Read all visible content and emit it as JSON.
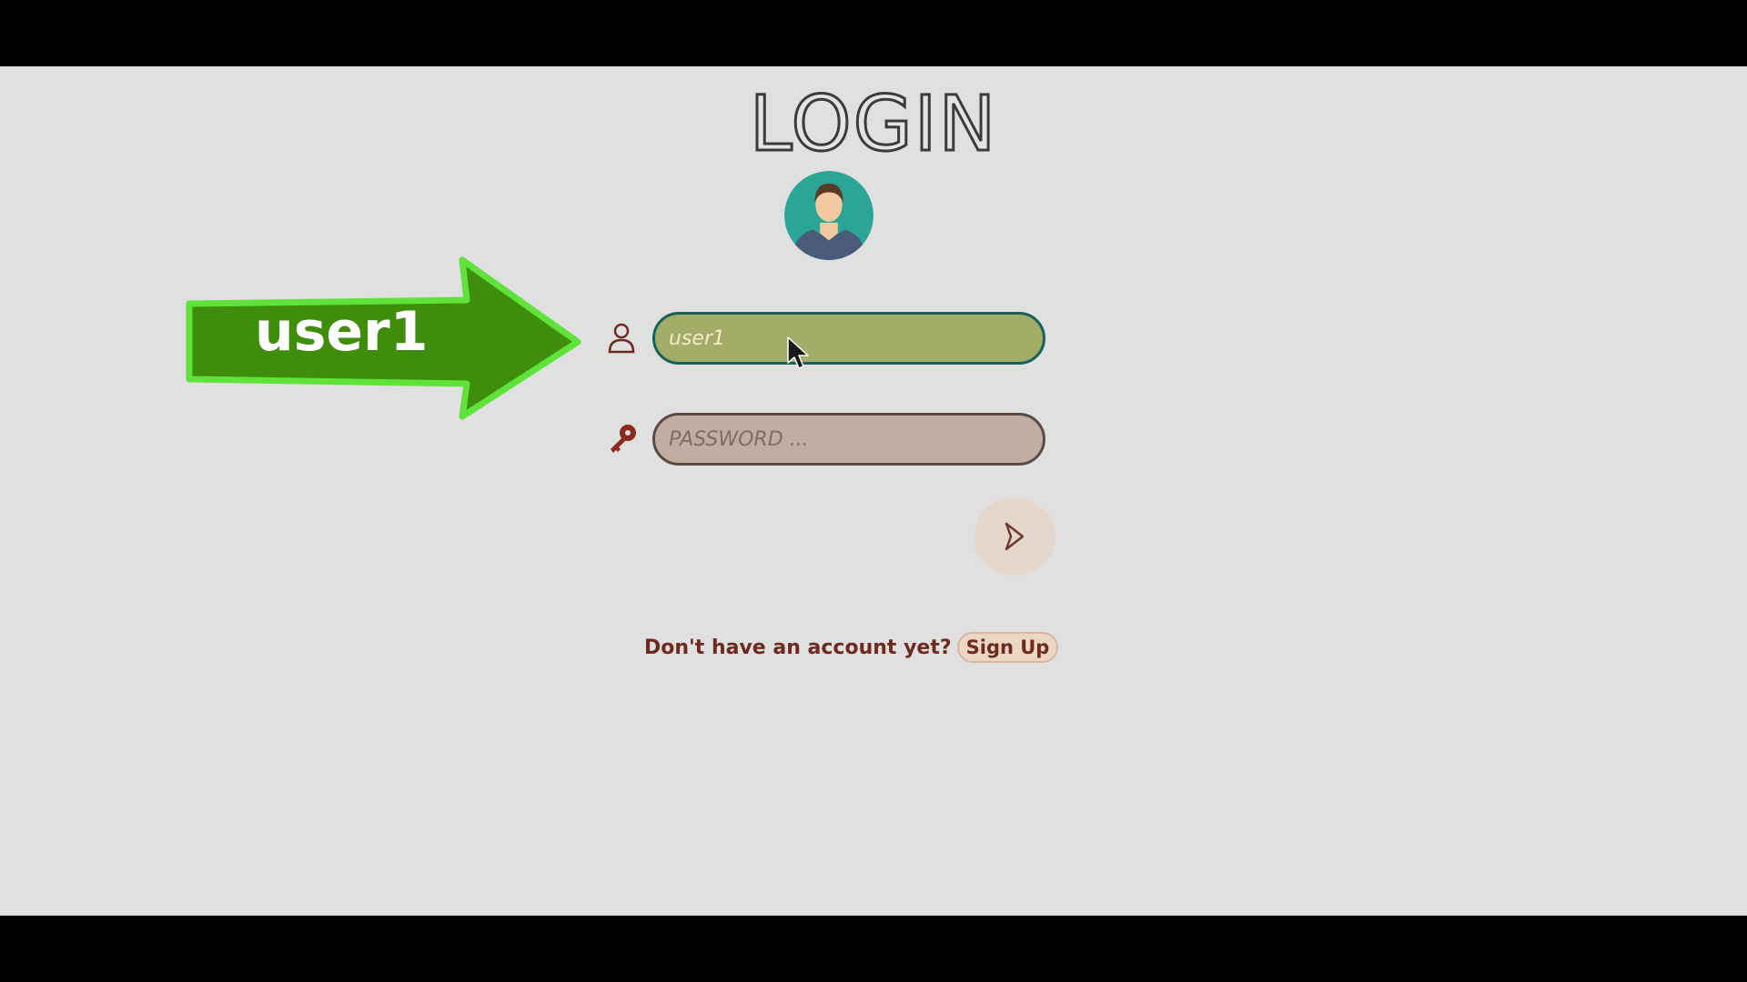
{
  "login": {
    "title": "LOGIN",
    "username_value": "user1",
    "password_placeholder": "PASSWORD ...",
    "signup_prompt": "Don't have an account yet?",
    "signup_label": "Sign Up"
  },
  "overlay": {
    "arrow_label": "user1",
    "arrow_color": "#3e8e0b",
    "arrow_outline": "#5fe23a"
  },
  "icons": {
    "field_user": "user-icon",
    "field_password": "key-icon",
    "submit": "chevron-right-icon",
    "avatar": "person-avatar"
  },
  "colors": {
    "background": "#e0e0e0",
    "username_fill": "#a3ad68",
    "username_border": "#17615c",
    "password_fill": "#c1ada1",
    "accent_text": "#6e2a1e"
  }
}
